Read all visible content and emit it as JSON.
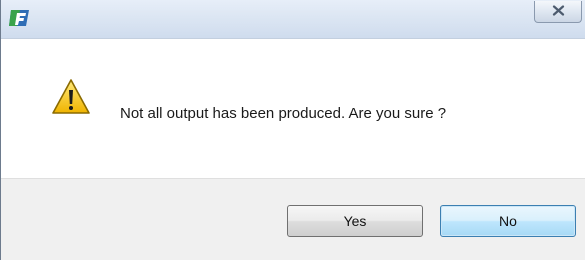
{
  "window": {
    "title": "",
    "app_icon": "app-logo-icon",
    "close_icon": "close-icon"
  },
  "dialog": {
    "icon": "warning-icon",
    "message": "Not all output has been produced. Are you sure ?"
  },
  "buttons": {
    "yes_label": "Yes",
    "no_label": "No"
  },
  "colors": {
    "warning_yellow": "#f2c200",
    "app_icon_green": "#3aa34a",
    "app_icon_blue": "#2f6db5",
    "default_button_border": "#3c7fb1",
    "footer_background": "#f0f0f0"
  }
}
